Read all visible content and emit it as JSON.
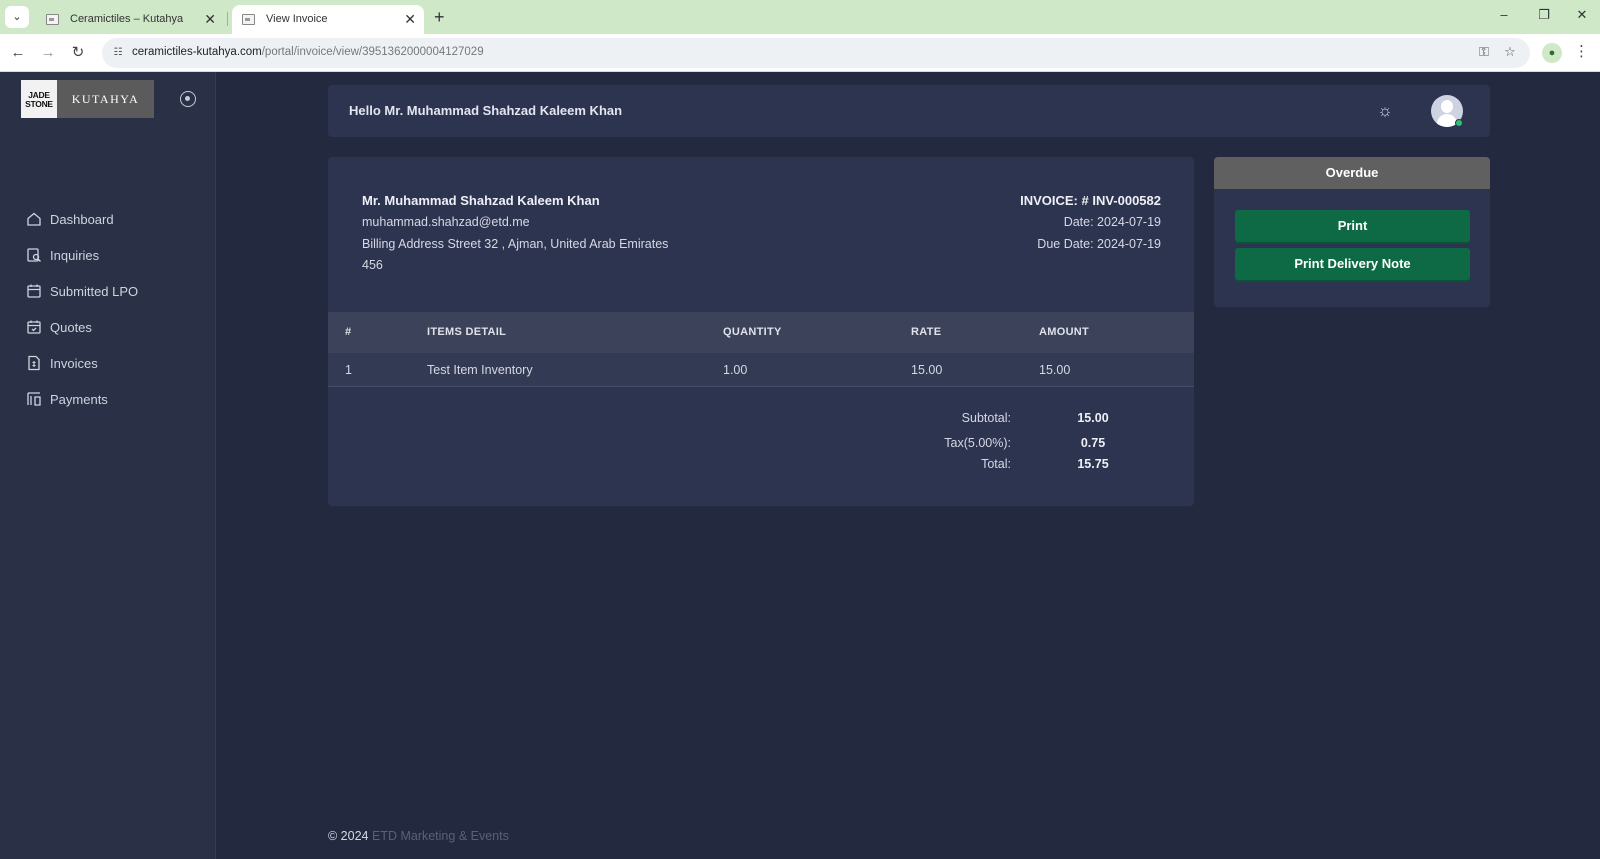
{
  "browser": {
    "tabs": [
      {
        "title": "Ceramictiles – Kutahya",
        "active": false
      },
      {
        "title": "View Invoice",
        "active": true
      }
    ],
    "url_host": "ceramictiles-kutahya.com",
    "url_path": "/portal/invoice/view/3951362000004127029"
  },
  "logo": {
    "left": "JADE STONE",
    "right": "KUTAHYA"
  },
  "sidebar": {
    "items": [
      {
        "label": "Dashboard",
        "icon": "home-icon"
      },
      {
        "label": "Inquiries",
        "icon": "inquiry-icon"
      },
      {
        "label": "Submitted LPO",
        "icon": "calendar-icon"
      },
      {
        "label": "Quotes",
        "icon": "calendar-check-icon"
      },
      {
        "label": "Invoices",
        "icon": "invoice-icon"
      },
      {
        "label": "Payments",
        "icon": "payments-icon"
      }
    ]
  },
  "header": {
    "greeting": "Hello Mr. Muhammad Shahzad Kaleem Khan"
  },
  "invoice": {
    "customer_name": "Mr. Muhammad Shahzad Kaleem Khan",
    "email": "muhammad.shahzad@etd.me",
    "address_line1": "Billing Address Street 32 , Ajman, United Arab Emirates",
    "address_line2": "456",
    "number": "INVOICE: # INV-000582",
    "date": "Date: 2024-07-19",
    "due_date": "Due Date: 2024-07-19",
    "columns": [
      "#",
      "ITEMS DETAIL",
      "QUANTITY",
      "RATE",
      "AMOUNT"
    ],
    "rows": [
      {
        "index": "1",
        "item": "Test Item Inventory",
        "quantity": "1.00",
        "rate": "15.00",
        "amount": "15.00"
      }
    ],
    "totals": {
      "subtotal_label": "Subtotal:",
      "subtotal": "15.00",
      "tax_label": "Tax(5.00%):",
      "tax": "0.75",
      "total_label": "Total:",
      "total": "15.75"
    }
  },
  "status": {
    "label": "Overdue",
    "print_label": "Print",
    "print_delivery_label": "Print Delivery Note"
  },
  "footer": {
    "copyright": "© 2024",
    "brand": "ETD Marketing & Events"
  },
  "colors": {
    "background": "#232a3f",
    "card": "#2d3450",
    "button": "#0e6a45",
    "status": "#606060"
  }
}
